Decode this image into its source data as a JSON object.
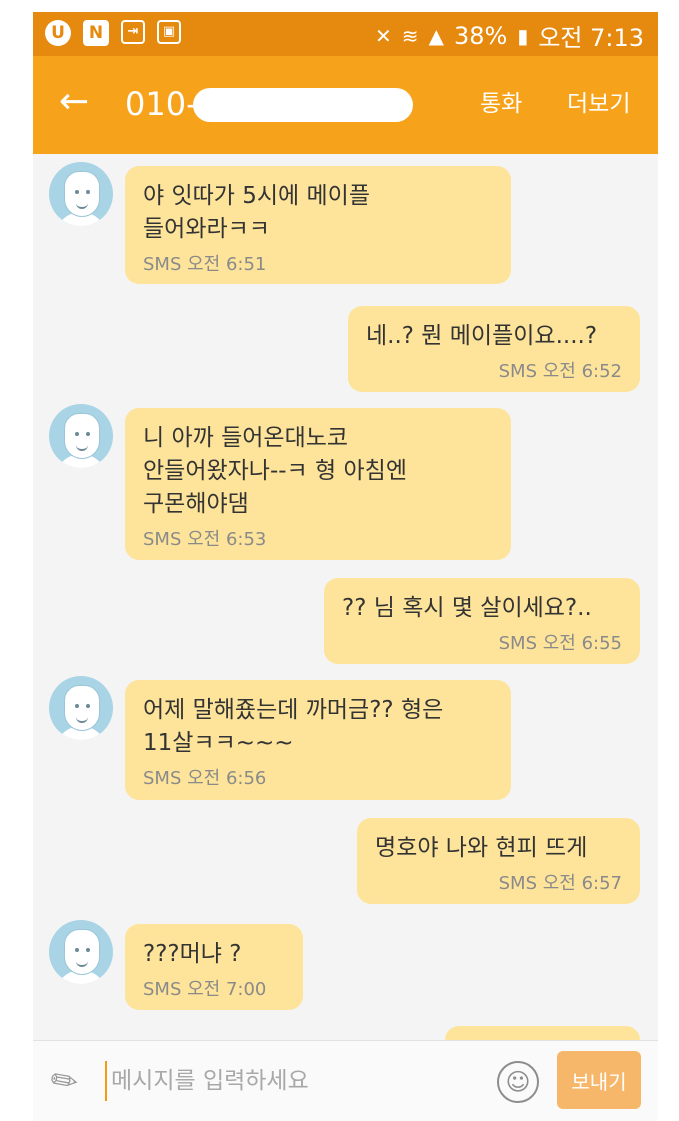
{
  "status_bar": {
    "icon1": "U",
    "icon2": "N",
    "battery": "38%",
    "time": "오전 7:13"
  },
  "header": {
    "back_icon": "back-arrow-icon",
    "phone_number": "010-",
    "call_label": "통화",
    "more_label": "더보기"
  },
  "messages": [
    {
      "direction": "in",
      "text": "야 잇따가 5시에 메이플\n들어와라ㅋㅋ",
      "meta": "SMS 오전 6:51"
    },
    {
      "direction": "out",
      "text": "네..? 뭔 메이플이요....?",
      "meta": "SMS 오전 6:52"
    },
    {
      "direction": "in",
      "text": "니 아까 들어온대노코\n안들어왔자나--ㅋ 형 아침엔\n구몬해야댐",
      "meta": "SMS 오전 6:53"
    },
    {
      "direction": "out",
      "text": "?? 님 혹시 몇 살이세요?..",
      "meta": "SMS 오전 6:55"
    },
    {
      "direction": "in",
      "text": "어제 말해죴는데 까머금??  형은\n11살ㅋㅋ~~~",
      "meta": "SMS 오전 6:56"
    },
    {
      "direction": "out",
      "text": "명호야 나와 현피 뜨게",
      "meta": "SMS 오전 6:57"
    },
    {
      "direction": "in",
      "text": "???머냐 ?",
      "meta": "SMS 오전 7:00"
    }
  ],
  "composer": {
    "placeholder": "메시지를 입력하세요",
    "send_label": "보내기"
  },
  "colors": {
    "status_bar": "#e6890f",
    "app_bar": "#f7a21b",
    "bubble": "#fde49a",
    "background": "#f4f4f4",
    "send_button": "#f7b76a"
  }
}
